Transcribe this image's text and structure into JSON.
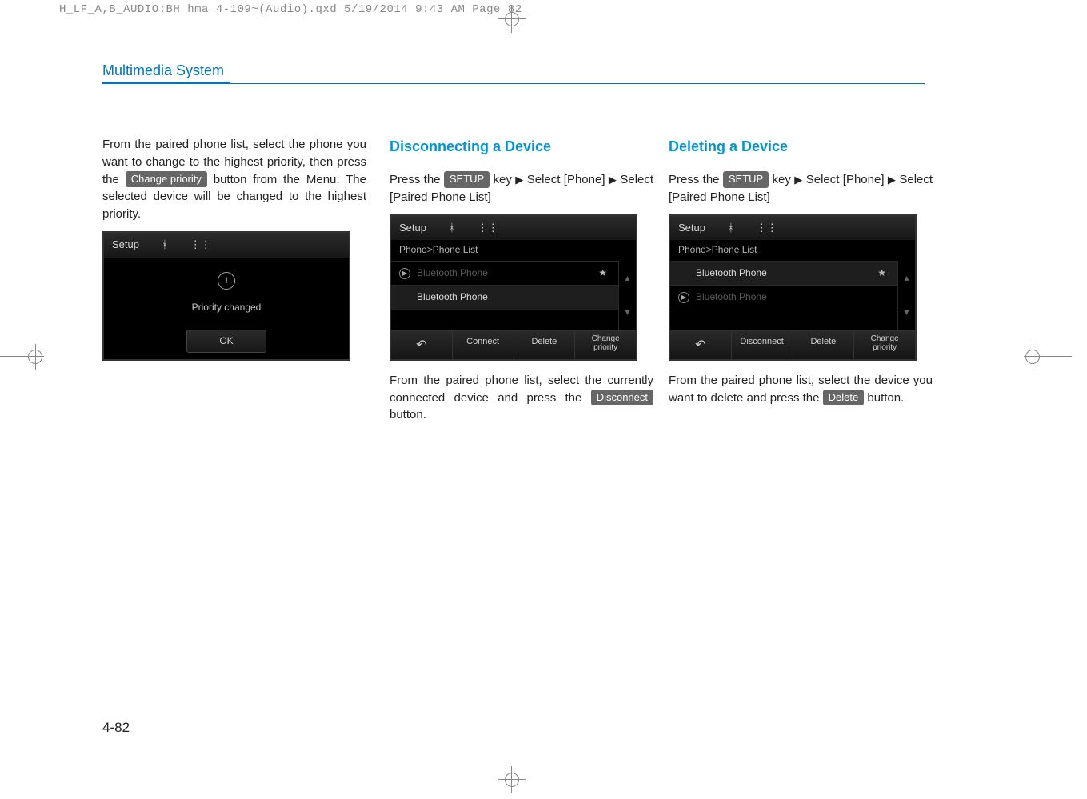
{
  "file_header": "H_LF_A,B_AUDIO:BH hma 4-109~(Audio).qxd  5/19/2014  9:43 AM  Page 82",
  "section_title": "Multimedia System",
  "page_number": "4-82",
  "col1": {
    "para1a": "From the paired phone list, select the phone you want to change to the highest priority, then press the ",
    "btn": "Change priority",
    "para1b": " button from the Menu. The selected device will be changed to the highest priority.",
    "shot": {
      "setup": "Setup",
      "msg": "Priority changed",
      "ok": "OK"
    }
  },
  "col2": {
    "heading": "Disconnecting a Device",
    "p_press": "Press the ",
    "btn_setup": "SETUP",
    "p_key": " key",
    "arrow": "▶",
    "p_sel1": "Select [Phone]",
    "p_sel2": "Select [Paired Phone List]",
    "shot": {
      "setup": "Setup",
      "crumb": "Phone>Phone List",
      "item_dim": "Bluetooth Phone",
      "item_sel": "Bluetooth Phone",
      "bot": {
        "connect": "Connect",
        "delete": "Delete",
        "change1": "Change",
        "change2": "priority"
      }
    },
    "after1": "From the paired phone list, select the currently connected device and press the ",
    "btn_disc": "Disconnect",
    "after2": " button."
  },
  "col3": {
    "heading": "Deleting a Device",
    "p_press": "Press the ",
    "btn_setup": "SETUP",
    "p_key": " key",
    "arrow": "▶",
    "p_sel1": "Select [Phone]",
    "p_sel2": "Select [Paired Phone List]",
    "shot": {
      "setup": "Setup",
      "crumb": "Phone>Phone List",
      "item_sel": "Bluetooth Phone",
      "item_dim": "Bluetooth Phone",
      "bot": {
        "disconnect": "Disconnect",
        "delete": "Delete",
        "change1": "Change",
        "change2": "priority"
      }
    },
    "after1": "From the paired phone list, select the device you want to delete and press the ",
    "btn_del": "Delete",
    "after2": " button."
  }
}
